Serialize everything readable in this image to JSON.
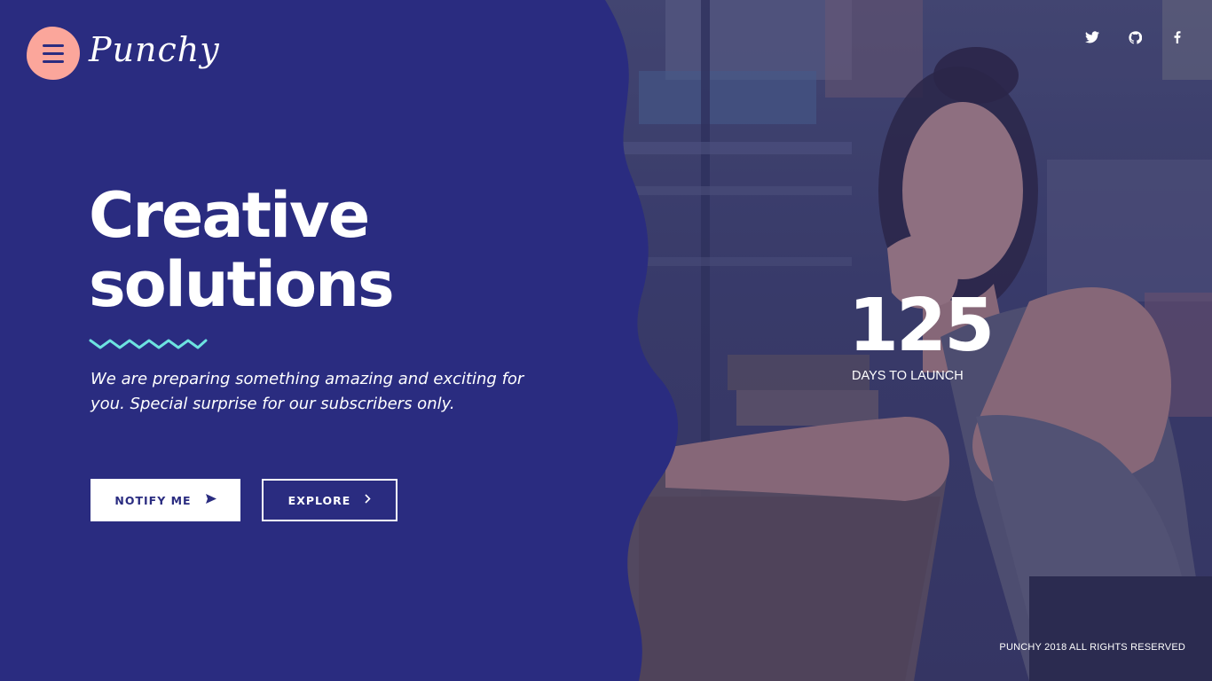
{
  "brand": {
    "logo_text": "Punchy",
    "accent_color": "#fba69b",
    "panel_color": "#2a2c80",
    "zigzag_color": "#6de3e0"
  },
  "header": {
    "menu_icon": "hamburger-icon",
    "social": [
      {
        "name": "twitter-icon"
      },
      {
        "name": "github-icon"
      },
      {
        "name": "facebook-icon"
      }
    ]
  },
  "hero": {
    "title_line1": "Creative",
    "title_line2": "solutions",
    "description": "We are preparing something amazing and exciting for you. Special surprise for our subscribers only.",
    "notify_label": "NOTIFY ME",
    "notify_icon": "paper-plane-icon",
    "explore_label": "EXPLORE",
    "explore_icon": "chevron-right-icon"
  },
  "countdown": {
    "value": "125",
    "label": "DAYS TO LAUNCH"
  },
  "footer": {
    "copyright": "PUNCHY 2018 ALL RIGHTS RESERVED"
  }
}
